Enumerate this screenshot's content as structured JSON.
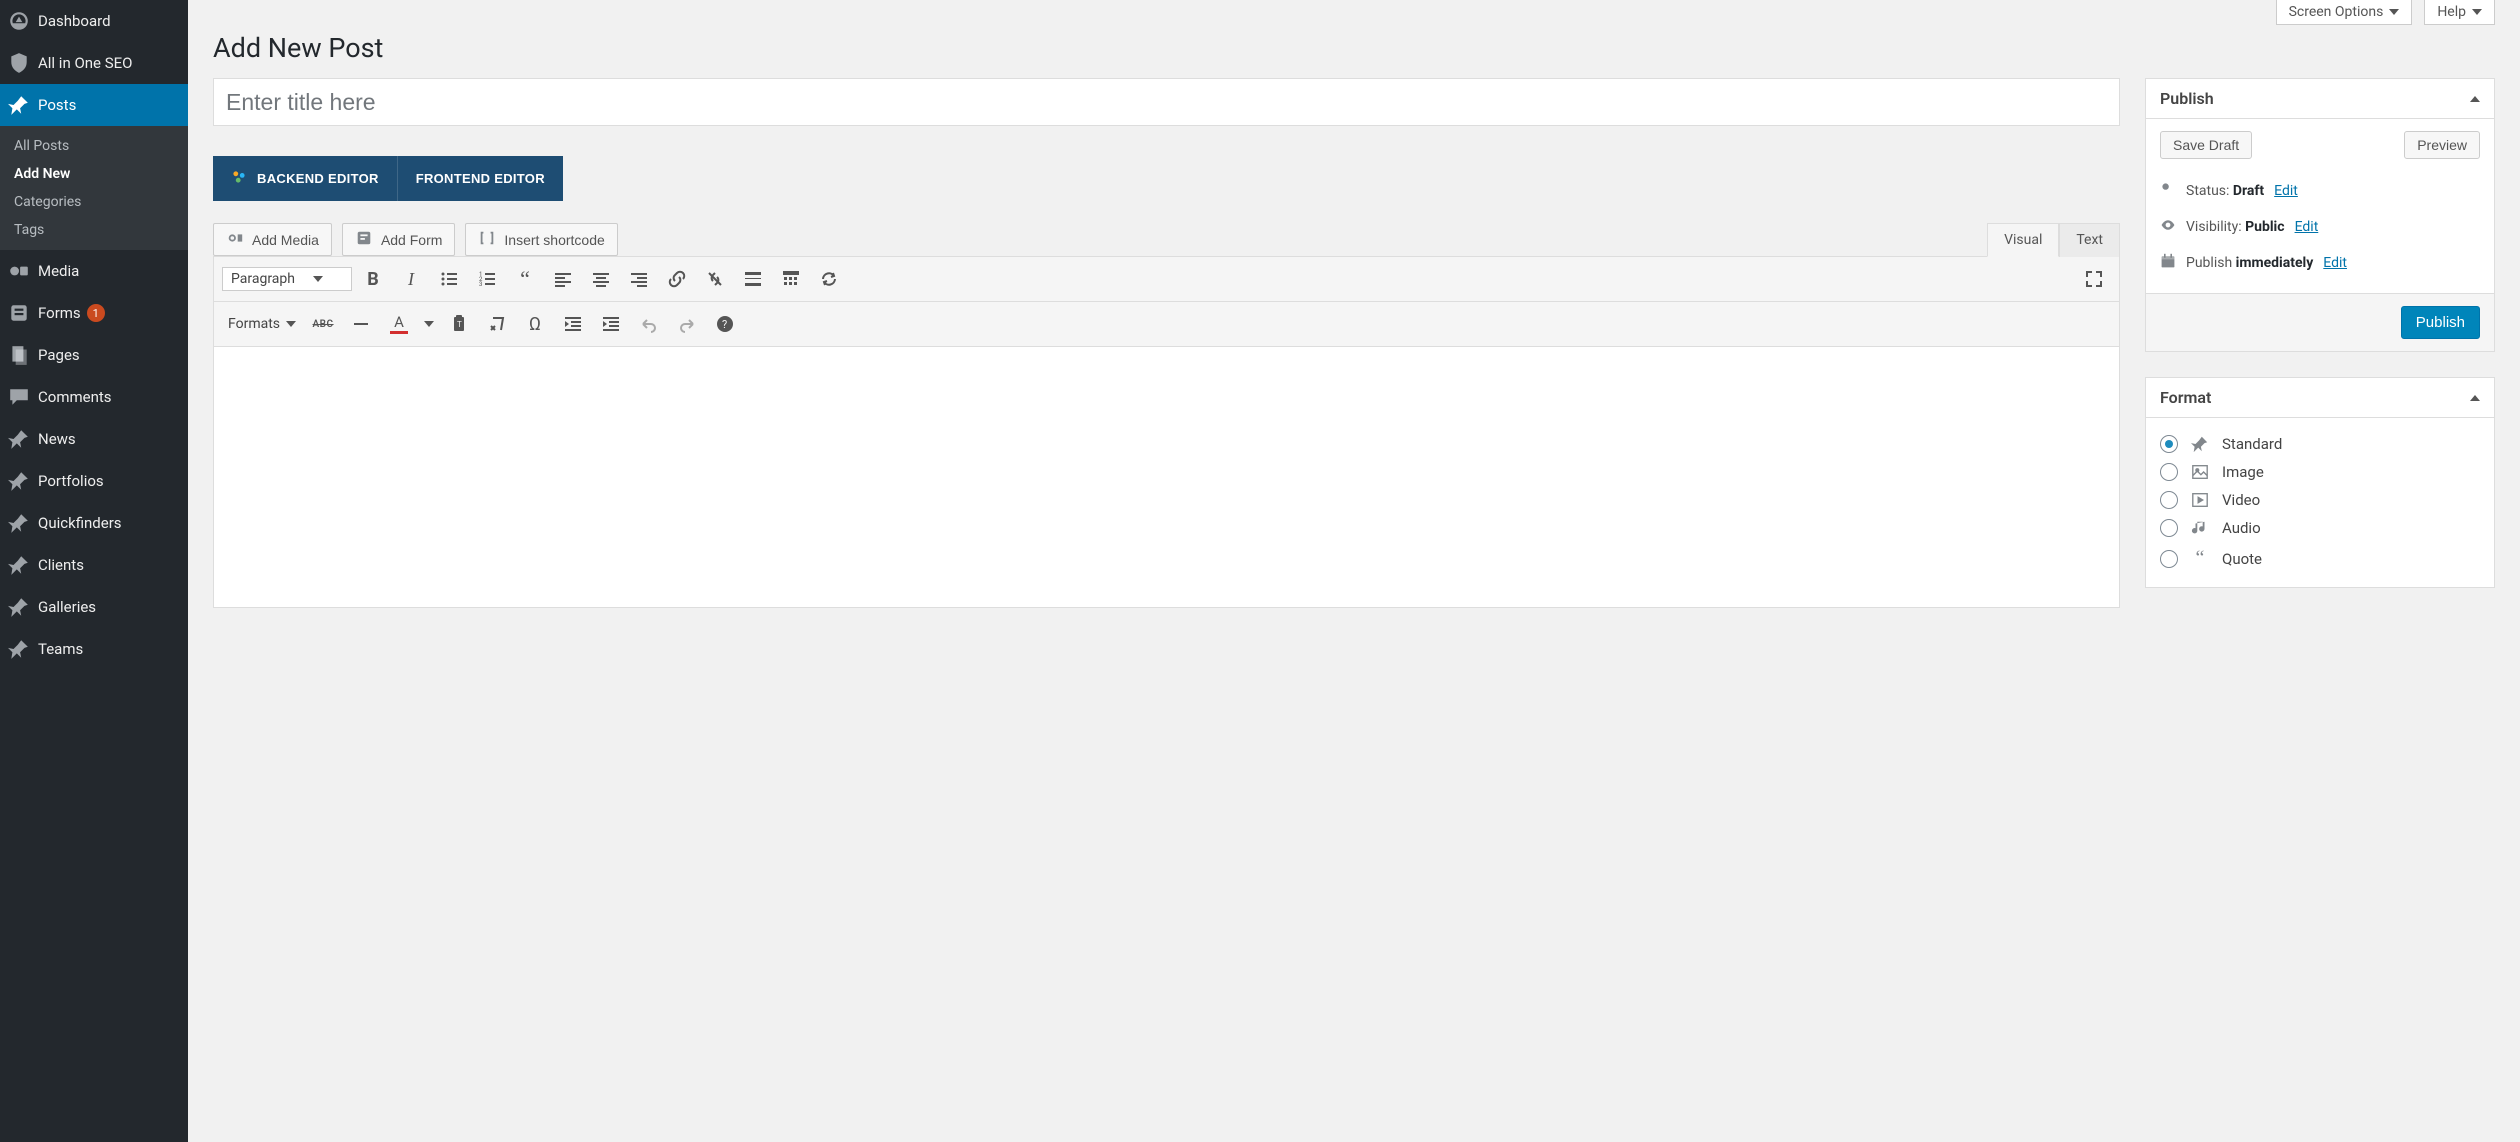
{
  "screen_buttons": {
    "options": "Screen Options",
    "help": "Help"
  },
  "sidebar": {
    "items": [
      {
        "label": "Dashboard",
        "icon": "dashboard-icon"
      },
      {
        "label": "All in One SEO",
        "icon": "shield-icon"
      },
      {
        "label": "Posts",
        "icon": "pin-icon",
        "active": true
      },
      {
        "label": "Media",
        "icon": "media-icon"
      },
      {
        "label": "Forms",
        "icon": "forms-icon",
        "badge": "1"
      },
      {
        "label": "Pages",
        "icon": "pages-icon"
      },
      {
        "label": "Comments",
        "icon": "comment-icon"
      },
      {
        "label": "News",
        "icon": "pin-icon"
      },
      {
        "label": "Portfolios",
        "icon": "pin-icon"
      },
      {
        "label": "Quickfinders",
        "icon": "pin-icon"
      },
      {
        "label": "Clients",
        "icon": "pin-icon"
      },
      {
        "label": "Galleries",
        "icon": "pin-icon"
      },
      {
        "label": "Teams",
        "icon": "pin-icon"
      }
    ],
    "posts_sub": [
      {
        "label": "All Posts"
      },
      {
        "label": "Add New",
        "current": true
      },
      {
        "label": "Categories"
      },
      {
        "label": "Tags"
      }
    ]
  },
  "page": {
    "title": "Add New Post"
  },
  "title_input": {
    "placeholder": "Enter title here"
  },
  "editor_modes": {
    "backend": "BACKEND EDITOR",
    "frontend": "FRONTEND EDITOR"
  },
  "media_buttons": {
    "add_media": "Add Media",
    "add_form": "Add Form",
    "shortcode": "Insert shortcode"
  },
  "editor_tabs": {
    "visual": "Visual",
    "text": "Text"
  },
  "toolbar": {
    "format_select": "Paragraph",
    "formats_label": "Formats"
  },
  "publish": {
    "title": "Publish",
    "save_draft": "Save Draft",
    "preview": "Preview",
    "status_label": "Status:",
    "status_value": "Draft",
    "visibility_label": "Visibility:",
    "visibility_value": "Public",
    "schedule_label": "Publish",
    "schedule_value": "immediately",
    "edit": "Edit",
    "submit": "Publish"
  },
  "format": {
    "title": "Format",
    "options": [
      {
        "label": "Standard",
        "icon": "pin-icon",
        "checked": true
      },
      {
        "label": "Image",
        "icon": "image-icon"
      },
      {
        "label": "Video",
        "icon": "video-icon"
      },
      {
        "label": "Audio",
        "icon": "audio-icon"
      },
      {
        "label": "Quote",
        "icon": "quote-icon"
      }
    ]
  }
}
